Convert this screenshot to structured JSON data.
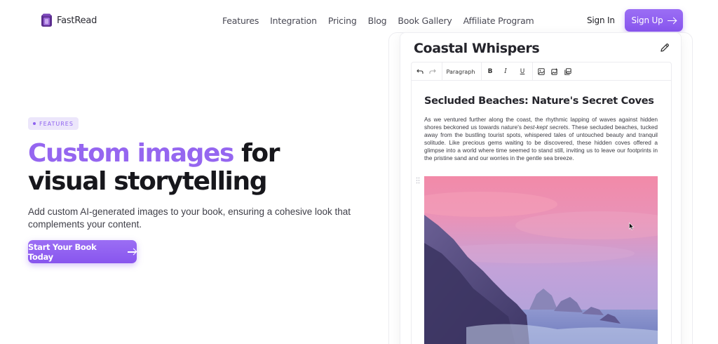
{
  "brand": {
    "name": "FastRead"
  },
  "nav": {
    "links": [
      "Features",
      "Integration",
      "Pricing",
      "Blog",
      "Book Gallery",
      "Affiliate Program"
    ],
    "sign_in": "Sign In",
    "sign_up": "Sign Up"
  },
  "hero": {
    "badge": "FEATURES",
    "headline_accent": "Custom images",
    "headline_rest": " for visual storytelling",
    "subtext": "Add custom AI-generated images to your book, ensuring a cohesive look that complements your content.",
    "cta": "Start Your Book Today"
  },
  "editor": {
    "book_title": "Coastal Whispers",
    "toolbar": {
      "block_type": "Paragraph",
      "bold": "B",
      "italic": "I",
      "underline": "U"
    },
    "heading": "Secluded Beaches: Nature's Secret Coves",
    "para_part1": "As we ventured further along the coast, the rhythmic lapping of waves against hidden shores beckoned us towards nature's ",
    "para_em": "best-kept secrets",
    "para_part2": ". These secluded beaches, tucked away from the bustling tourist spots, whispered tales of untouched beauty and tranquil solitude. Like precious gems waiting to be discovered, these hidden coves offered a glimpse into a world where time seemed to stand still, inviting us to leave our footprints in the pristine sand and our worries in the gentle sea breeze."
  },
  "colors": {
    "accent": "#8e62ef",
    "badge_bg": "#ece6fb",
    "heading": "#17171c"
  },
  "icons": [
    "book-logo-icon",
    "arrow-right-icon",
    "pencil-icon",
    "undo-icon",
    "redo-icon",
    "image-icon",
    "image-add-icon",
    "gallery-icon",
    "drag-handle-icon"
  ]
}
